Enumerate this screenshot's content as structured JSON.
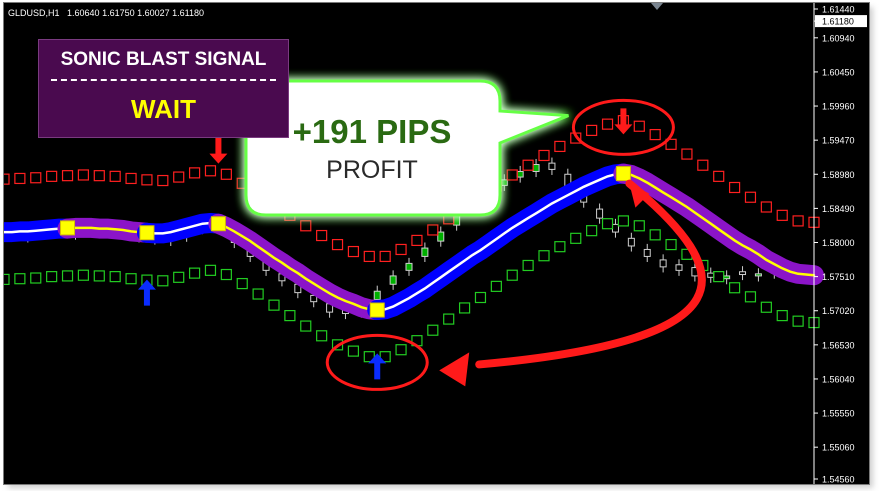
{
  "header": {
    "symbol": "GLDUSD,H1",
    "quote": "1.60640 1.61750 1.60027 1.61180"
  },
  "signal_panel": {
    "title": "SONIC BLAST SIGNAL",
    "status": "WAIT"
  },
  "callout": {
    "pips": "+191 PIPS",
    "label": "PROFIT"
  },
  "colors": {
    "background": "#000000",
    "ma_band": "#0000ff",
    "ma_band_down": "#8b14c8",
    "ma_core_up": "#ffffff",
    "ma_core_down": "#ffff00",
    "upper_band": "#ff2020",
    "lower_band": "#22cc22",
    "buy_arrow": "#0a2cff",
    "sell_arrow": "#ff1a1a",
    "callout_fill": "#ffffff",
    "callout_glow": "#66ff44"
  },
  "chart_data": {
    "type": "line",
    "title": "",
    "xlabel": "",
    "ylabel": "",
    "ylim": [
      1.5456,
      1.6144
    ],
    "y_ticks": [
      "1.61440",
      "1.61180",
      "1.60940",
      "1.60450",
      "1.59960",
      "1.59470",
      "1.58980",
      "1.58490",
      "1.58000",
      "1.57510",
      "1.57020",
      "1.56530",
      "1.56040",
      "1.55550",
      "1.55060",
      "1.54560"
    ],
    "current_price": 1.6118,
    "grid": false,
    "x": [
      0,
      1,
      2,
      3,
      4,
      5,
      6,
      7,
      8,
      9,
      10,
      11,
      12,
      13,
      14,
      15,
      16,
      17,
      18,
      19,
      20,
      21,
      22,
      23,
      24,
      25,
      26,
      27,
      28,
      29,
      30,
      31,
      32,
      33,
      34,
      35,
      36,
      37,
      38,
      39,
      40,
      41,
      42,
      43,
      44,
      45,
      46,
      47,
      48,
      49,
      50,
      51,
      52,
      53,
      54,
      55,
      56,
      57,
      58,
      59,
      60,
      61,
      62,
      63,
      64,
      65,
      66,
      67,
      68,
      69,
      70,
      71,
      72,
      73,
      74,
      75,
      76,
      77,
      78,
      79,
      80,
      81,
      82,
      83,
      84,
      85,
      86,
      87,
      88,
      89,
      90,
      91,
      92,
      93,
      94,
      95,
      96,
      97,
      98,
      99,
      100,
      101,
      102
    ],
    "series": [
      {
        "name": "",
        "role": "moving_average",
        "values": [
          1.5815,
          1.5815,
          1.5816,
          1.5816,
          1.5817,
          1.5818,
          1.5819,
          1.582,
          1.582,
          1.5821,
          1.5821,
          1.5821,
          1.582,
          1.582,
          1.5819,
          1.5818,
          1.5816,
          1.5815,
          1.5814,
          1.5813,
          1.5813,
          1.5815,
          1.5818,
          1.5821,
          1.5824,
          1.5827,
          1.5828,
          1.5827,
          1.5822,
          1.5816,
          1.5809,
          1.5802,
          1.5794,
          1.5786,
          1.5778,
          1.5771,
          1.5763,
          1.5756,
          1.5748,
          1.5741,
          1.5734,
          1.5727,
          1.5721,
          1.5716,
          1.5712,
          1.5707,
          1.5704,
          1.5703,
          1.5704,
          1.5708,
          1.5714,
          1.572,
          1.5727,
          1.5734,
          1.5742,
          1.575,
          1.5758,
          1.5766,
          1.5774,
          1.5782,
          1.5789,
          1.5797,
          1.5805,
          1.5813,
          1.5821,
          1.5828,
          1.5835,
          1.5842,
          1.5849,
          1.5856,
          1.5862,
          1.5868,
          1.5874,
          1.588,
          1.5885,
          1.589,
          1.5895,
          1.5898,
          1.5899,
          1.5897,
          1.5892,
          1.5886,
          1.5879,
          1.5872,
          1.5865,
          1.5858,
          1.5851,
          1.5843,
          1.5835,
          1.5827,
          1.5819,
          1.5811,
          1.5803,
          1.5796,
          1.579,
          1.5783,
          1.5775,
          1.5769,
          1.5763,
          1.5758,
          1.5755,
          1.5754,
          1.5753
        ],
        "color_segments": [
          {
            "from": 0,
            "to": 8,
            "trend": "up"
          },
          {
            "from": 8,
            "to": 18,
            "trend": "down"
          },
          {
            "from": 18,
            "to": 27,
            "trend": "up"
          },
          {
            "from": 27,
            "to": 47,
            "trend": "down"
          },
          {
            "from": 47,
            "to": 78,
            "trend": "up"
          },
          {
            "from": 78,
            "to": 102,
            "trend": "down"
          }
        ]
      },
      {
        "name": "",
        "role": "upper_band",
        "marker": "square",
        "color": "#ff2020",
        "values": [
          1.5891,
          1.5892,
          1.5892,
          1.5893,
          1.5893,
          1.5894,
          1.5895,
          1.5896,
          1.5896,
          1.5897,
          1.5897,
          1.5897,
          1.5896,
          1.5896,
          1.5895,
          1.5894,
          1.5892,
          1.5891,
          1.589,
          1.5889,
          1.5889,
          1.5891,
          1.5894,
          1.5897,
          1.59,
          1.5902,
          1.5903,
          1.5902,
          1.5898,
          1.5892,
          1.5885,
          1.5878,
          1.587,
          1.5862,
          1.5853,
          1.5846,
          1.5839,
          1.5832,
          1.5824,
          1.5817,
          1.581,
          1.5803,
          1.5797,
          1.5791,
          1.5787,
          1.5783,
          1.578,
          1.5779,
          1.578,
          1.5784,
          1.579,
          1.5796,
          1.5803,
          1.581,
          1.5818,
          1.5826,
          1.5834,
          1.5842,
          1.585,
          1.5858,
          1.5865,
          1.5873,
          1.5881,
          1.5889,
          1.5897,
          1.5904,
          1.5911,
          1.5918,
          1.5925,
          1.5932,
          1.5938,
          1.5944,
          1.595,
          1.5956,
          1.5961,
          1.5966,
          1.597,
          1.5974,
          1.5975,
          1.5973,
          1.5967,
          1.5962,
          1.5955,
          1.5948,
          1.5941,
          1.5934,
          1.5927,
          1.5919,
          1.5911,
          1.5903,
          1.5895,
          1.5887,
          1.5879,
          1.5872,
          1.5865,
          1.5858,
          1.5851,
          1.5845,
          1.5839,
          1.5834,
          1.5831,
          1.583,
          1.5829
        ]
      },
      {
        "name": "",
        "role": "lower_band",
        "marker": "square",
        "color": "#22cc22",
        "values": [
          1.5747,
          1.5748,
          1.5748,
          1.5749,
          1.5749,
          1.575,
          1.5751,
          1.5752,
          1.5752,
          1.5753,
          1.5753,
          1.5753,
          1.5752,
          1.5752,
          1.5751,
          1.575,
          1.5748,
          1.5747,
          1.5746,
          1.5745,
          1.5745,
          1.5747,
          1.575,
          1.5753,
          1.5756,
          1.5759,
          1.576,
          1.5759,
          1.5754,
          1.5748,
          1.5741,
          1.5734,
          1.5726,
          1.5718,
          1.571,
          1.5703,
          1.5695,
          1.5688,
          1.568,
          1.5673,
          1.5666,
          1.5659,
          1.5653,
          1.5648,
          1.5644,
          1.5639,
          1.5636,
          1.5635,
          1.5636,
          1.564,
          1.5646,
          1.5652,
          1.5659,
          1.5666,
          1.5674,
          1.5682,
          1.569,
          1.5698,
          1.5706,
          1.5714,
          1.5721,
          1.5729,
          1.5737,
          1.5745,
          1.5753,
          1.576,
          1.5767,
          1.5774,
          1.5781,
          1.5788,
          1.5794,
          1.58,
          1.5806,
          1.5812,
          1.5817,
          1.5822,
          1.5827,
          1.583,
          1.5831,
          1.5829,
          1.5824,
          1.5818,
          1.5811,
          1.5804,
          1.5797,
          1.579,
          1.5783,
          1.5775,
          1.5767,
          1.5759,
          1.5751,
          1.5743,
          1.5735,
          1.5728,
          1.5722,
          1.5715,
          1.5707,
          1.5701,
          1.5695,
          1.569,
          1.5687,
          1.5686,
          1.5685
        ]
      }
    ],
    "signal_points": [
      {
        "x": 8,
        "y": 1.5821
      },
      {
        "x": 18,
        "y": 1.5814
      },
      {
        "x": 27,
        "y": 1.5827
      },
      {
        "x": 47,
        "y": 1.5703
      },
      {
        "x": 78,
        "y": 1.5899
      }
    ],
    "arrows": [
      {
        "type": "buy",
        "x": 18,
        "y": 1.5728
      },
      {
        "type": "sell",
        "x": 27,
        "y": 1.5932
      },
      {
        "type": "buy",
        "x": 47,
        "y": 1.5622
      },
      {
        "type": "sell",
        "x": 78,
        "y": 1.5974
      }
    ],
    "candles": {
      "start_x": 1,
      "step": 2,
      "close": [
        1.5812,
        1.5808,
        1.582,
        1.5815,
        1.5822,
        1.5818,
        1.5824,
        1.5815,
        1.5808,
        1.5805,
        1.581,
        1.5816,
        1.583,
        1.5825,
        1.58,
        1.578,
        1.576,
        1.5745,
        1.5728,
        1.5715,
        1.57,
        1.5698,
        1.5712,
        1.573,
        1.5752,
        1.577,
        1.5792,
        1.5815,
        1.5838,
        1.586,
        1.5878,
        1.589,
        1.5902,
        1.5912,
        1.5905,
        1.588,
        1.5858,
        1.5835,
        1.5815,
        1.5795,
        1.578,
        1.5765,
        1.576,
        1.5752,
        1.575,
        1.5752,
        1.5754,
        1.5755,
        1.5756,
        1.5757
      ],
      "open": [
        1.5818,
        1.5814,
        1.5812,
        1.5823,
        1.5812,
        1.5824,
        1.5814,
        1.5822,
        1.5815,
        1.5811,
        1.5803,
        1.5809,
        1.582,
        1.5833,
        1.5818,
        1.5796,
        1.5774,
        1.5755,
        1.574,
        1.5724,
        1.5712,
        1.5706,
        1.57,
        1.5718,
        1.574,
        1.576,
        1.578,
        1.5802,
        1.5825,
        1.5846,
        1.5868,
        1.5882,
        1.5894,
        1.5902,
        1.5914,
        1.5898,
        1.5872,
        1.5848,
        1.5826,
        1.5806,
        1.579,
        1.5775,
        1.5768,
        1.5764,
        1.5756,
        1.5748,
        1.5758,
        1.5752,
        1.576,
        1.5753
      ]
    }
  }
}
